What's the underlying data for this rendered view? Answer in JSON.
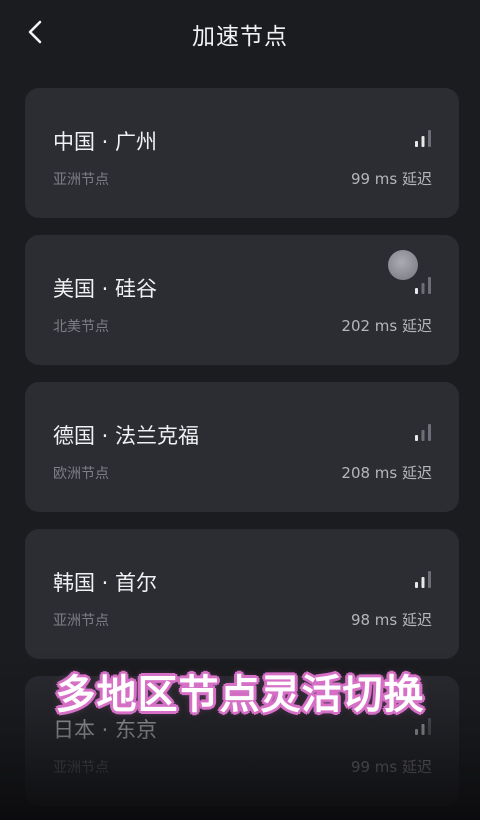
{
  "header": {
    "title": "加速节点",
    "back_icon": "chevron-left-icon"
  },
  "nodes": [
    {
      "name": "中国 · 广州",
      "region": "亚洲节点",
      "latency": "99 ms 延迟",
      "signal_icon": "signal-bars-icon"
    },
    {
      "name": "美国 · 硅谷",
      "region": "北美节点",
      "latency": "202 ms 延迟",
      "signal_icon": "signal-bars-icon"
    },
    {
      "name": "德国 · 法兰克福",
      "region": "欧洲节点",
      "latency": "208 ms 延迟",
      "signal_icon": "signal-bars-icon"
    },
    {
      "name": "韩国 · 首尔",
      "region": "亚洲节点",
      "latency": "98 ms 延迟",
      "signal_icon": "signal-bars-icon"
    },
    {
      "name": "日本 · 东京",
      "region": "亚洲节点",
      "latency": "99 ms 延迟",
      "signal_icon": "signal-bars-icon"
    }
  ],
  "caption": "多地区节点灵活切换",
  "colors": {
    "background": "#1b1c20",
    "card": "#2c2d33",
    "caption_outline": "#d66fc6"
  }
}
